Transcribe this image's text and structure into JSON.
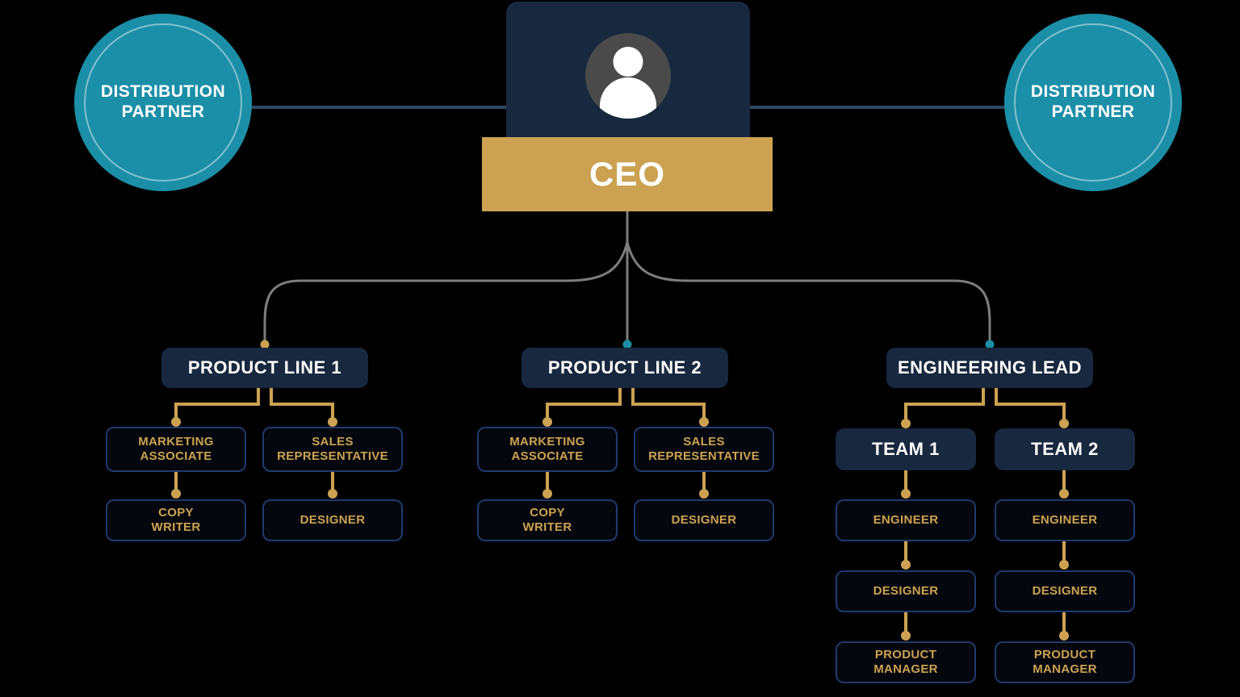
{
  "colors": {
    "navy": "#17283F",
    "gold": "#CCA252",
    "teal": "#1B8FA8",
    "wire_gray": "#7D7D7D",
    "wire_gold": "#CCA252",
    "border_blue": "#1F3A6E",
    "background": "#000000",
    "text_white": "#FFFFFF"
  },
  "partners": {
    "left": {
      "label": "DISTRIBUTION\nPARTNER",
      "icon": "circle-badge"
    },
    "right": {
      "label": "DISTRIBUTION\nPARTNER",
      "icon": "circle-badge"
    }
  },
  "ceo": {
    "label": "CEO",
    "avatar_icon": "person-avatar-icon"
  },
  "branches": [
    {
      "head": "PRODUCT LINE 1",
      "children": [
        {
          "label": "MARKETING\nASSOCIATE",
          "child": "COPY\nWRITER"
        },
        {
          "label": "SALES\nREPRESENTATIVE",
          "child": "DESIGNER"
        }
      ]
    },
    {
      "head": "PRODUCT LINE 2",
      "children": [
        {
          "label": "MARKETING\nASSOCIATE",
          "child": "COPY\nWRITER"
        },
        {
          "label": "SALES\nREPRESENTATIVE",
          "child": "DESIGNER"
        }
      ]
    },
    {
      "head": "ENGINEERING LEAD",
      "children": [
        {
          "label": "TEAM 1",
          "chain": [
            "ENGINEER",
            "DESIGNER",
            "PRODUCT\nMANAGER"
          ]
        },
        {
          "label": "TEAM 2",
          "chain": [
            "ENGINEER",
            "DESIGNER",
            "PRODUCT\nMANAGER"
          ]
        }
      ]
    }
  ]
}
